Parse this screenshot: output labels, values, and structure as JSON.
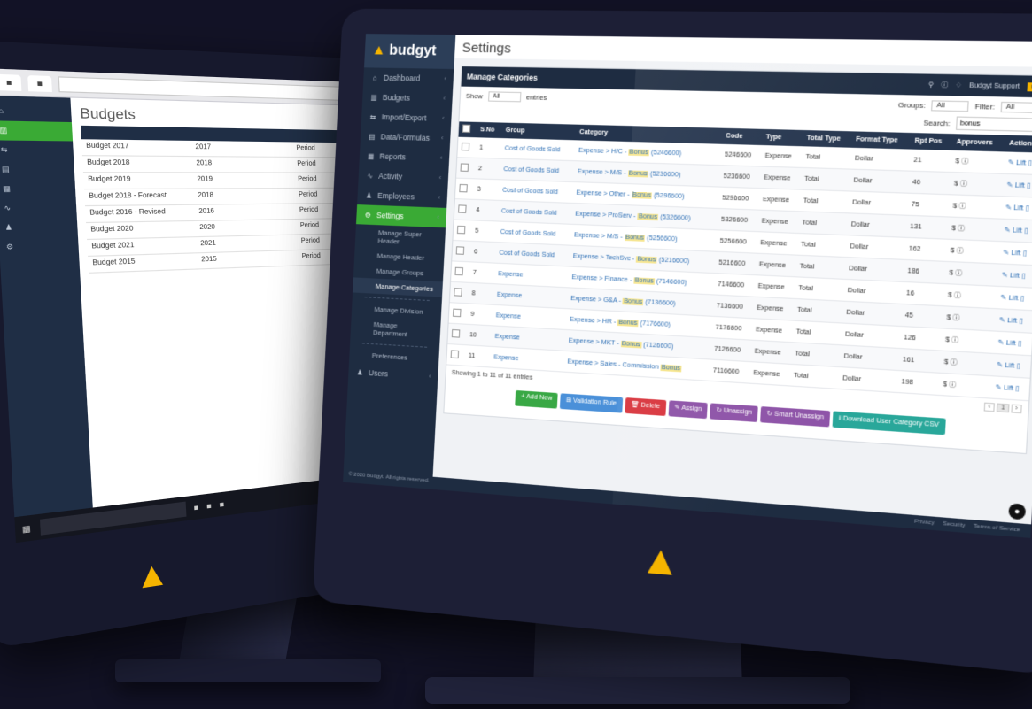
{
  "colors": {
    "brand_yellow": "#f5b400",
    "sidebar_navy": "#1e2c41",
    "active_green": "#3aaa35",
    "background": "#121226"
  },
  "back_monitor": {
    "page_title": "Budgets",
    "rows": [
      {
        "c1": "Budget 2017",
        "c2": "2017",
        "c3": "Period",
        "actions": "✎ ⧉ ✉ > ⊖ ▮"
      },
      {
        "c1": "Budget 2018",
        "c2": "2018",
        "c3": "Period",
        "actions": "✎ ⧉ ✉ > ⊖ ▮"
      },
      {
        "c1": "Budget 2019",
        "c2": "2019",
        "c3": "Period",
        "actions": "✎ ⧉ ✉ > ⊖ ▮"
      },
      {
        "c1": "Budget 2018 - Forecast",
        "c2": "2018",
        "c3": "Period",
        "actions": "✎ ⧉ ✉ > ⊖ ▮"
      },
      {
        "c1": "Budget 2016 - Revised",
        "c2": "2016",
        "c3": "Period",
        "actions": "✎ ⧉ ✉ > ⊖ ▮"
      },
      {
        "c1": "Budget 2020",
        "c2": "2020",
        "c3": "Period",
        "actions": "✎ ⧉ ✉ > ⊖ ▮"
      },
      {
        "c1": "Budget 2021",
        "c2": "2021",
        "c3": "Period",
        "actions": "✎ ⧉ ✉ > ⊖ ▮"
      },
      {
        "c1": "Budget 2015",
        "c2": "2015",
        "c3": "Period",
        "actions": "✎ ⧉ ✉ > ⊖ ▮"
      }
    ]
  },
  "brand": {
    "name": "budgyt"
  },
  "sidebar": {
    "items": [
      {
        "label": "Dashboard",
        "icon": "⌂"
      },
      {
        "label": "Budgets",
        "icon": "▥"
      },
      {
        "label": "Import/Export",
        "icon": "⇆"
      },
      {
        "label": "Data/Formulas",
        "icon": "▤"
      },
      {
        "label": "Reports",
        "icon": "▦"
      },
      {
        "label": "Activity",
        "icon": "∿"
      },
      {
        "label": "Employees",
        "icon": "♟"
      },
      {
        "label": "Settings",
        "icon": "⚙"
      }
    ],
    "sub_items": [
      {
        "label": "Manage Super Header"
      },
      {
        "label": "Manage Header"
      },
      {
        "label": "Manage Groups"
      },
      {
        "label": "Manage Categories"
      },
      {
        "label": "Manage Division"
      },
      {
        "label": "Manage Department"
      },
      {
        "label": "Preferences"
      }
    ],
    "users_label": "Users",
    "footer": "© 2020 Budgyt. All rights reserved."
  },
  "main": {
    "title": "Settings",
    "panel_title": "Manage Categories",
    "user_label": "Budgyt Support",
    "show_label": "Show",
    "show_value": "All",
    "entries_label": "entries",
    "groups_label": "Groups:",
    "groups_value": "All",
    "filter_label": "Filter:",
    "filter_value": "All",
    "search_label": "Search:",
    "search_value": "bonus",
    "columns": [
      "S.No",
      "Group",
      "Category",
      "Code",
      "Type",
      "Total Type",
      "Format Type",
      "Rpt Pos",
      "Approvers",
      "Action"
    ],
    "rows": [
      {
        "sno": "1",
        "group": "Cost of Goods Sold",
        "cat_pre": "Expense > H/C - ",
        "cat_bonus": "Bonus",
        "cat_post": " (5246600)",
        "code": "5246600",
        "type": "Expense",
        "total": "Total",
        "format": "Dollar",
        "rpt": "21",
        "appr": "$ ⓘ",
        "action": "✎ Lift ▯"
      },
      {
        "sno": "2",
        "group": "Cost of Goods Sold",
        "cat_pre": "Expense > M/S - ",
        "cat_bonus": "Bonus",
        "cat_post": " (5236600)",
        "code": "5236600",
        "type": "Expense",
        "total": "Total",
        "format": "Dollar",
        "rpt": "46",
        "appr": "$ ⓘ",
        "action": "✎ Lift ▯"
      },
      {
        "sno": "3",
        "group": "Cost of Goods Sold",
        "cat_pre": "Expense > Other - ",
        "cat_bonus": "Bonus",
        "cat_post": " (5296600)",
        "code": "5296600",
        "type": "Expense",
        "total": "Total",
        "format": "Dollar",
        "rpt": "75",
        "appr": "$ ⓘ",
        "action": "✎ Lift ▯"
      },
      {
        "sno": "4",
        "group": "Cost of Goods Sold",
        "cat_pre": "Expense > ProServ - ",
        "cat_bonus": "Bonus",
        "cat_post": " (5326600)",
        "code": "5326600",
        "type": "Expense",
        "total": "Total",
        "format": "Dollar",
        "rpt": "131",
        "appr": "$ ⓘ",
        "action": "✎ Lift ▯"
      },
      {
        "sno": "5",
        "group": "Cost of Goods Sold",
        "cat_pre": "Expense > M/S - ",
        "cat_bonus": "Bonus",
        "cat_post": " (5256600)",
        "code": "5256600",
        "type": "Expense",
        "total": "Total",
        "format": "Dollar",
        "rpt": "162",
        "appr": "$ ⓘ",
        "action": "✎ Lift ▯"
      },
      {
        "sno": "6",
        "group": "Cost of Goods Sold",
        "cat_pre": "Expense > TechSvc - ",
        "cat_bonus": "Bonus",
        "cat_post": " (5216600)",
        "code": "5216600",
        "type": "Expense",
        "total": "Total",
        "format": "Dollar",
        "rpt": "186",
        "appr": "$ ⓘ",
        "action": "✎ Lift ▯"
      },
      {
        "sno": "7",
        "group": "Expense",
        "cat_pre": "Expense > Finance - ",
        "cat_bonus": "Bonus",
        "cat_post": " (7146600)",
        "code": "7146600",
        "type": "Expense",
        "total": "Total",
        "format": "Dollar",
        "rpt": "16",
        "appr": "$ ⓘ",
        "action": "✎ Lift ▯"
      },
      {
        "sno": "8",
        "group": "Expense",
        "cat_pre": "Expense > G&A - ",
        "cat_bonus": "Bonus",
        "cat_post": " (7136600)",
        "code": "7136600",
        "type": "Expense",
        "total": "Total",
        "format": "Dollar",
        "rpt": "45",
        "appr": "$ ⓘ",
        "action": "✎ Lift ▯"
      },
      {
        "sno": "9",
        "group": "Expense",
        "cat_pre": "Expense > HR - ",
        "cat_bonus": "Bonus",
        "cat_post": " (7176600)",
        "code": "7176600",
        "type": "Expense",
        "total": "Total",
        "format": "Dollar",
        "rpt": "126",
        "appr": "$ ⓘ",
        "action": "✎ Lift ▯"
      },
      {
        "sno": "10",
        "group": "Expense",
        "cat_pre": "Expense > MKT - ",
        "cat_bonus": "Bonus",
        "cat_post": " (7126600)",
        "code": "7126600",
        "type": "Expense",
        "total": "Total",
        "format": "Dollar",
        "rpt": "161",
        "appr": "$ ⓘ",
        "action": "✎ Lift ▯"
      },
      {
        "sno": "11",
        "group": "Expense",
        "cat_pre": "Expense > Sales - Commission ",
        "cat_bonus": "Bonus",
        "cat_post": "",
        "code": "7116600",
        "type": "Expense",
        "total": "Total",
        "format": "Dollar",
        "rpt": "198",
        "appr": "$ ⓘ",
        "action": "✎ Lift ▯"
      }
    ],
    "showing_text": "Showing 1 to 11 of 11 entries",
    "pager": {
      "prev": "‹",
      "page": "1",
      "next": "›"
    },
    "buttons": {
      "add_new": "+ Add New",
      "validation_rule": "⊞ Validation Rule",
      "delete": "🗑 Delete",
      "assign": "✎ Assign",
      "unassign": "↻ Unassign",
      "smart_unassign": "↻ Smart Unassign",
      "download_csv": "⭳ Download User Category CSV"
    },
    "footer_links": [
      "Privacy",
      "Security",
      "Terms of Service"
    ]
  }
}
